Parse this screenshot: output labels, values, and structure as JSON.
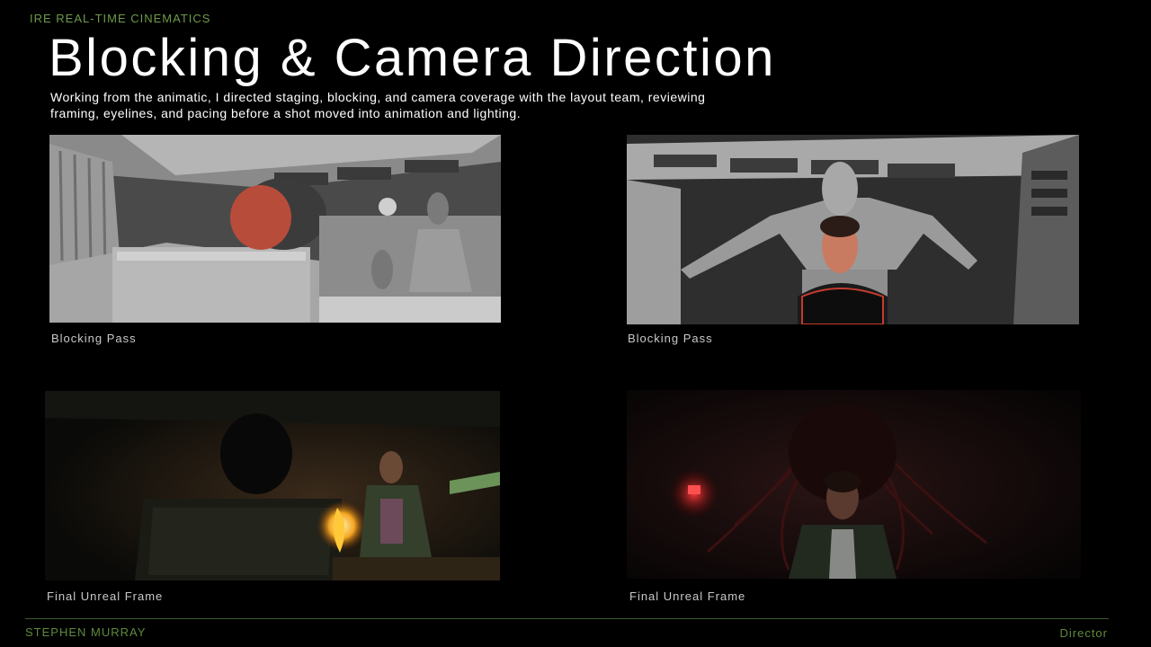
{
  "header": {
    "eyebrow": "IRE REAL-TIME CINEMATICS",
    "title": "Blocking & Camera Direction",
    "subtitle": "Working from the animatic, I directed staging, blocking, and camera coverage with the layout team, reviewing framing, eyelines, and pacing before a shot moved into animation and lighting."
  },
  "frames": [
    {
      "caption": "Blocking Pass"
    },
    {
      "caption": "Blocking Pass"
    },
    {
      "caption": "Final Unreal Frame"
    },
    {
      "caption": "Final Unreal Frame"
    }
  ],
  "footer": {
    "name": "STEPHEN MURRAY",
    "role": "Director"
  },
  "colors": {
    "accent_green": "#6e9a48",
    "background": "#000000"
  }
}
